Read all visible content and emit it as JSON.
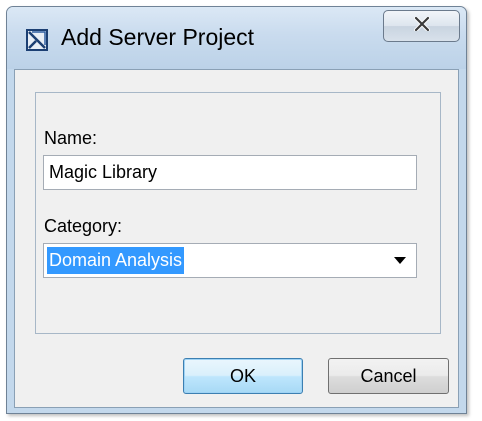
{
  "window": {
    "title": "Add Server Project",
    "icon": "app-window-icon",
    "close_icon": "close-x-icon"
  },
  "form": {
    "name_label": "Name:",
    "name_value": "Magic Library",
    "category_label": "Category:",
    "category_value": "Domain Analysis",
    "category_dropdown_icon": "chevron-down-icon"
  },
  "buttons": {
    "ok_label": "OK",
    "cancel_label": "Cancel"
  },
  "colors": {
    "titlebar": "#c9dbee",
    "selection_highlight": "#3399ff",
    "default_button_border": "#3c7fb1"
  }
}
